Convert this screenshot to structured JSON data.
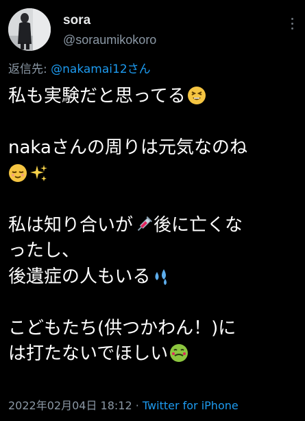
{
  "tweet": {
    "display_name": "sora",
    "handle": "@soraumikokoro",
    "reply_prefix": "返信先: ",
    "reply_mention": "@nakamai12さん",
    "lines": [
      "私も実験だと思ってる",
      "",
      "nakaさんの周りは元気なのね",
      "",
      "",
      "私は知り合いが",
      "後に亡くな",
      "ったし、",
      "後遺症の人もいる",
      "",
      "こどもたち(供つかわん！)に",
      "は打たないでほしい"
    ],
    "timestamp": "2022年02月04日 18:12",
    "separator": " · ",
    "source": "Twitter for iPhone"
  },
  "icons": {
    "more": "more-vertical-icon",
    "emoji_1": "grinning-squint-emoji",
    "emoji_2": "relieved-face-emoji",
    "emoji_3": "sparkles-emoji",
    "emoji_4": "syringe-emoji",
    "emoji_5": "sweat-droplets-emoji",
    "emoji_6": "nauseated-face-emoji"
  },
  "colors": {
    "background": "#000000",
    "text": "#ffffff",
    "secondary": "#8b98a5",
    "link": "#1d9bf0"
  }
}
